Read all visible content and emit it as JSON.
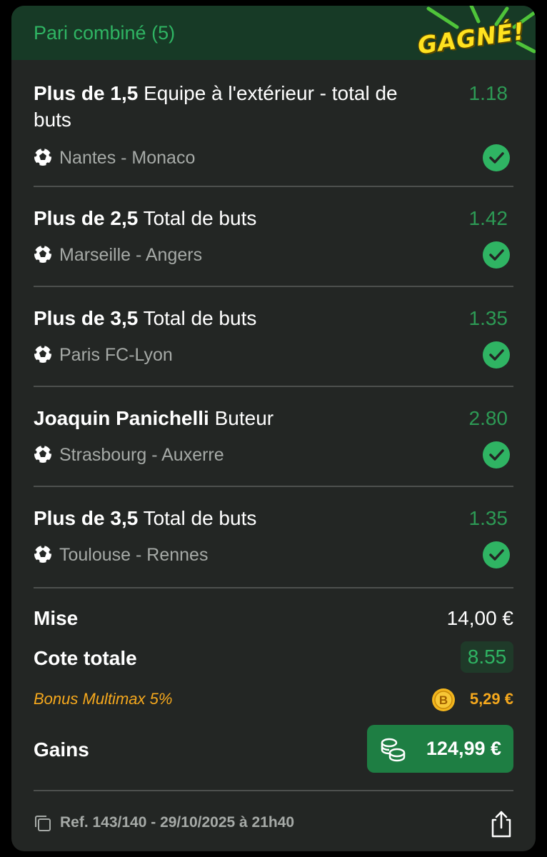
{
  "header": {
    "title": "Pari combiné (5)",
    "badge": "GAGNÉ!"
  },
  "selections": [
    {
      "market_bold": "Plus de 1,5",
      "market_rest": " Equipe à l'extérieur - total de buts",
      "odd": "1.18",
      "match": "Nantes - Monaco"
    },
    {
      "market_bold": "Plus de 2,5",
      "market_rest": " Total de buts",
      "odd": "1.42",
      "match": "Marseille - Angers"
    },
    {
      "market_bold": "Plus de 3,5",
      "market_rest": " Total de buts",
      "odd": "1.35",
      "match": "Paris FC-Lyon"
    },
    {
      "market_bold": "Joaquin Panichelli",
      "market_rest": " Buteur",
      "odd": "2.80",
      "match": "Strasbourg - Auxerre"
    },
    {
      "market_bold": "Plus de 3,5",
      "market_rest": " Total de buts",
      "odd": "1.35",
      "match": "Toulouse - Rennes"
    }
  ],
  "summary": {
    "stake_label": "Mise",
    "stake_value": "14,00 €",
    "total_odds_label": "Cote totale",
    "total_odds_value": "8.55",
    "bonus_label": "Bonus Multimax 5%",
    "bonus_coin_letter": "B",
    "bonus_value": "5,29 €",
    "gains_label": "Gains",
    "gains_value": "124,99 €"
  },
  "footer": {
    "ref": "Ref. 143/140  -  29/10/2025 à 21h40"
  },
  "colors": {
    "accent_green": "#2fb463",
    "odd_green": "#2d9a55",
    "bonus_orange": "#f5a81d",
    "gains_button": "#1e7e43"
  }
}
